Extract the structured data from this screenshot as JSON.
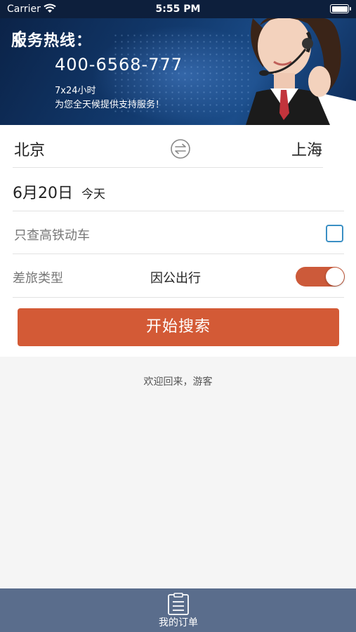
{
  "status_bar": {
    "carrier": "Carrier",
    "time": "5:55 PM"
  },
  "banner": {
    "title": "服务热线：",
    "phone": "400-6568-777",
    "hours": "7x24小时",
    "support": "为您全天候提供支持服务！"
  },
  "route": {
    "from_city": "北京",
    "to_city": "上海"
  },
  "date": {
    "value": "6月20日",
    "relative": "今天"
  },
  "high_speed_only": {
    "label": "只查高铁动车",
    "checked": false
  },
  "travel_type": {
    "label": "差旅类型",
    "value": "因公出行",
    "toggle_on": true
  },
  "search_button": {
    "label": "开始搜索"
  },
  "welcome": "欢迎回来，游客",
  "tab_bar": {
    "my_orders_label": "我的订单"
  },
  "colors": {
    "accent": "#d35a36",
    "checkbox_border": "#3a8fc4",
    "tab_bar": "#5a6d8c",
    "banner": "#123a6e"
  },
  "icons": [
    "wifi-icon",
    "battery-icon",
    "back-icon",
    "swap-icon",
    "order-list-icon"
  ]
}
